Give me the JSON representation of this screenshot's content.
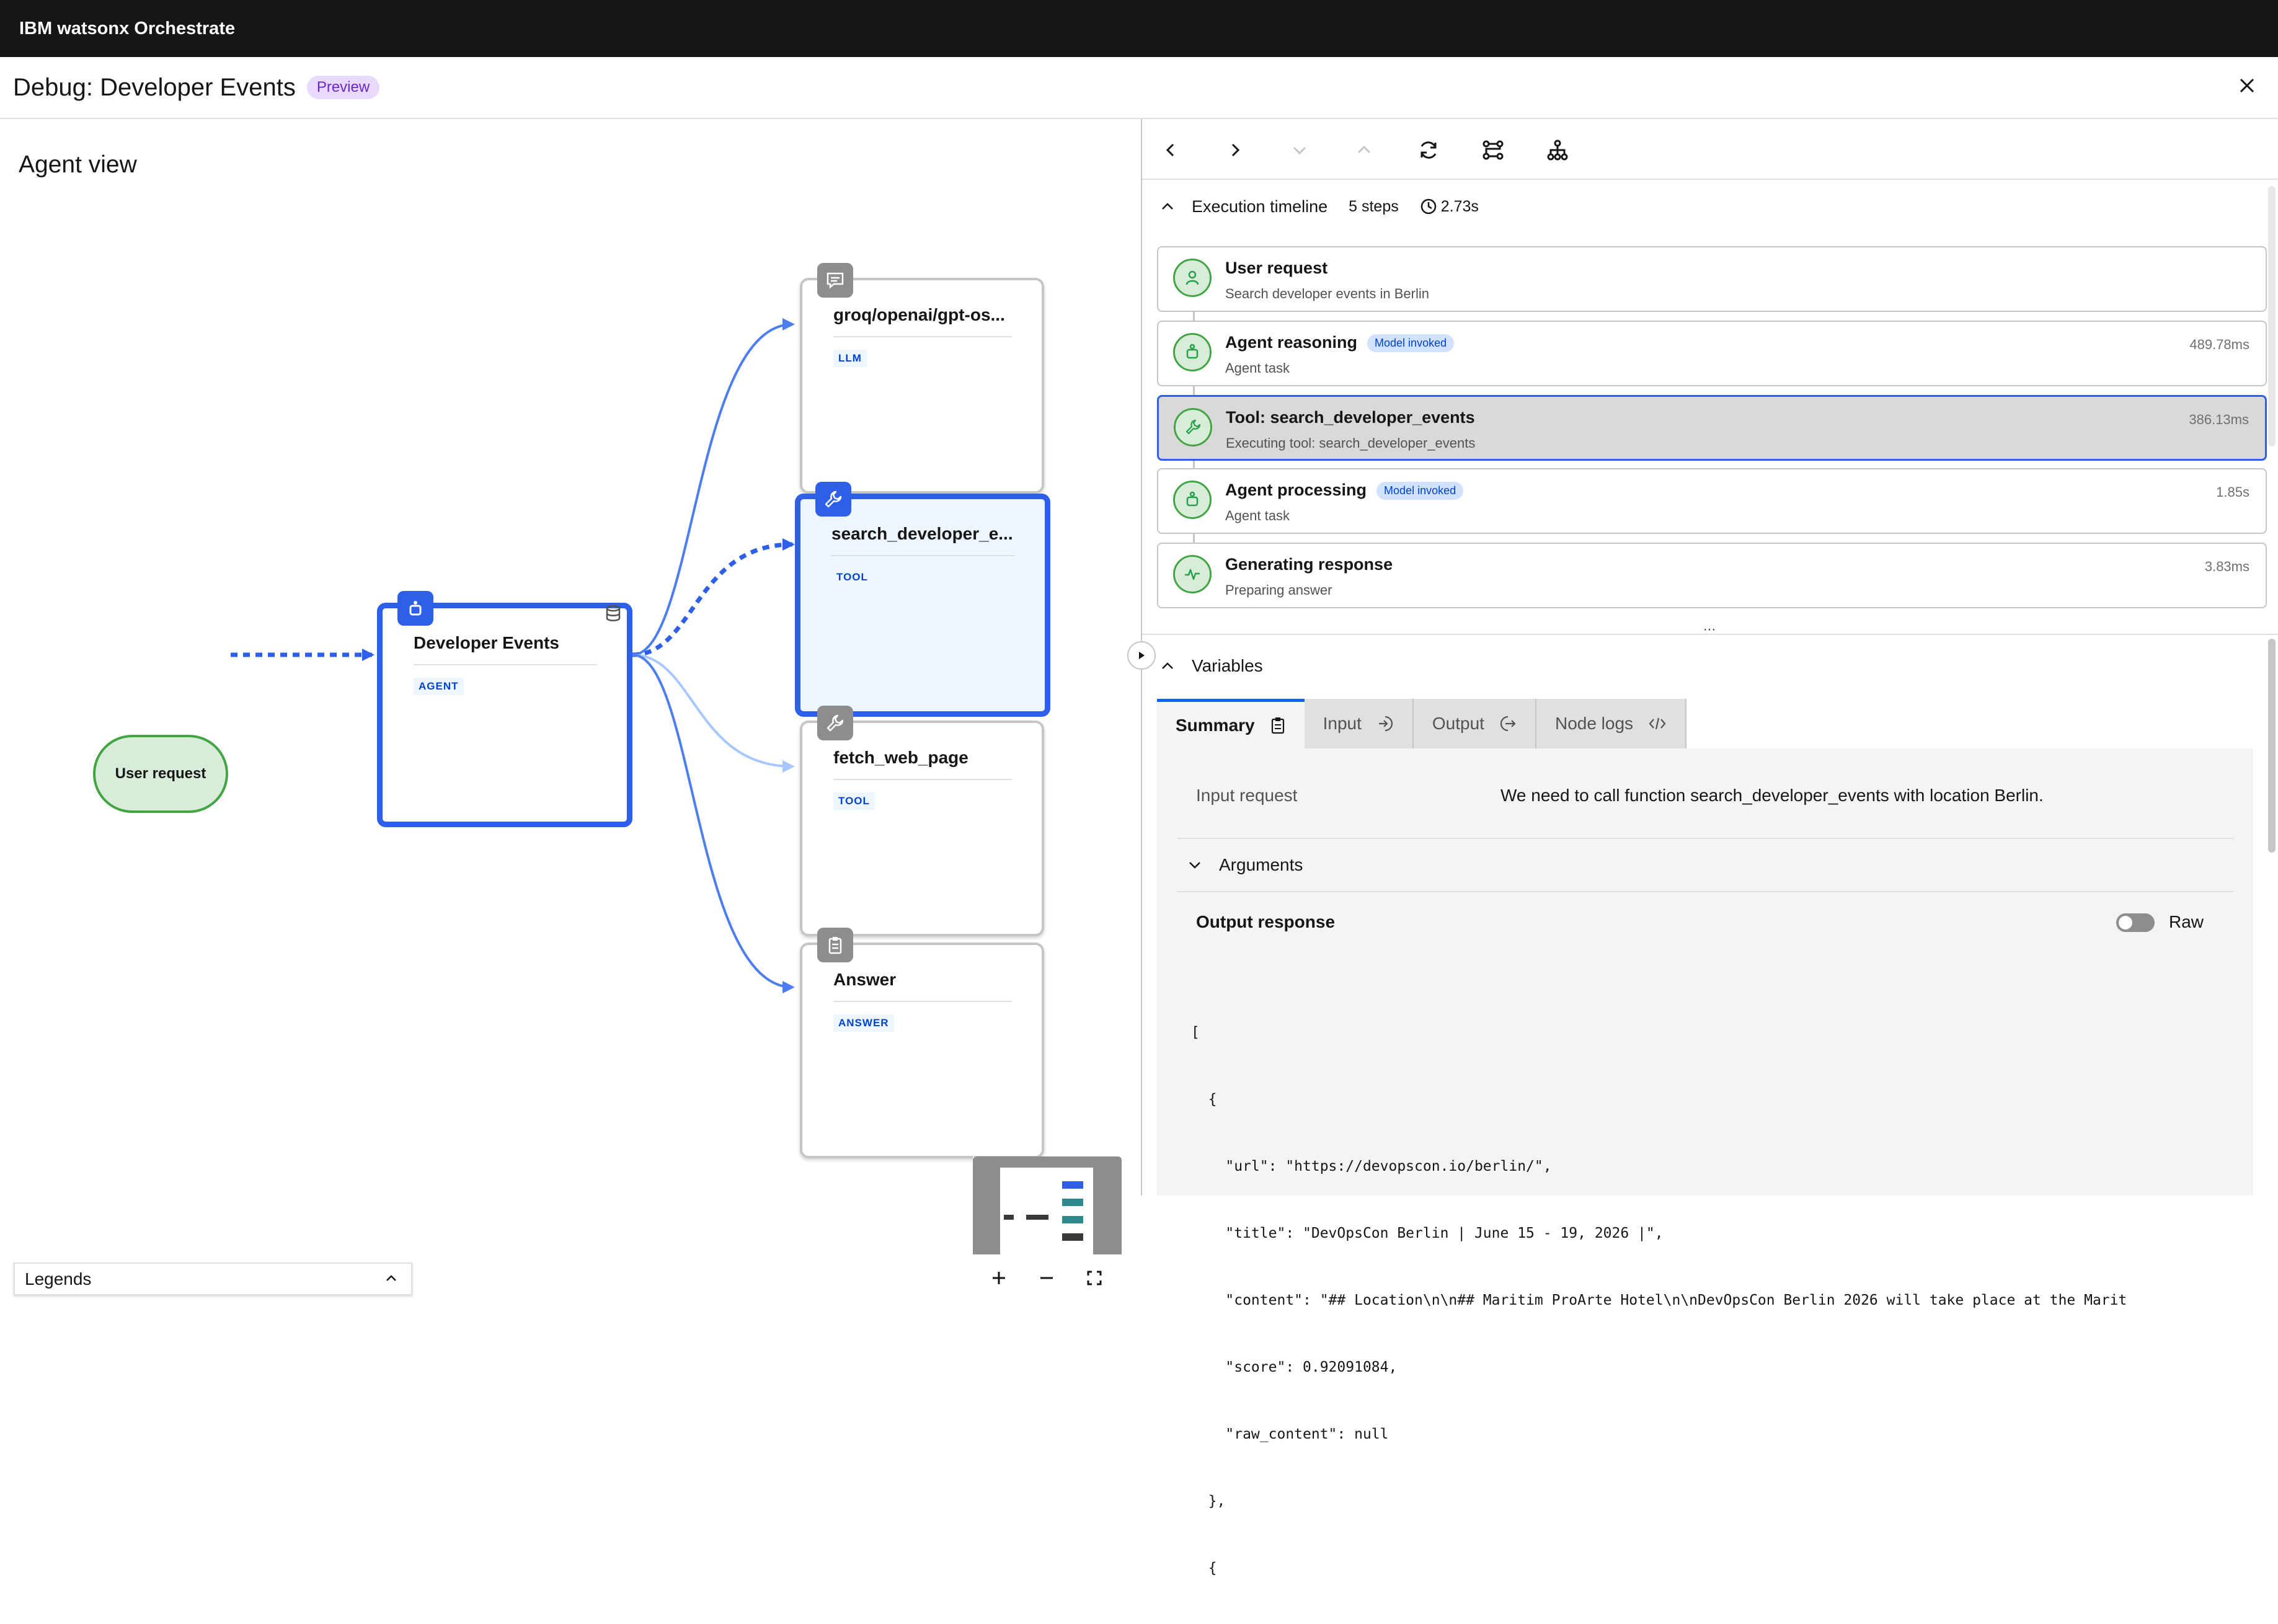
{
  "app": {
    "title": "IBM watsonx Orchestrate"
  },
  "debug": {
    "title": "Debug: Developer Events",
    "badge": "Preview"
  },
  "agent_view": {
    "title": "Agent view",
    "user_request_label": "User request",
    "agent_node": {
      "label": "Developer Events",
      "tag": "AGENT",
      "icon": "agent-icon"
    },
    "nodes": [
      {
        "label": "groq/openai/gpt-os...",
        "tag": "LLM",
        "icon": "chat-icon"
      },
      {
        "label": "search_developer_e...",
        "tag": "TOOL",
        "icon": "wrench-icon"
      },
      {
        "label": "fetch_web_page",
        "tag": "TOOL",
        "icon": "wrench-icon"
      },
      {
        "label": "Answer",
        "tag": "ANSWER",
        "icon": "clipboard-icon"
      }
    ],
    "legends_label": "Legends"
  },
  "timeline": {
    "title": "Execution timeline",
    "steps_count": "5 steps",
    "duration": "2.73s",
    "steps": [
      {
        "title": "User request",
        "subtitle": "Search developer events in Berlin",
        "time": "",
        "badge": ""
      },
      {
        "title": "Agent reasoning",
        "subtitle": "Agent task",
        "time": "489.78ms",
        "badge": "Model invoked"
      },
      {
        "title": "Tool: search_developer_events",
        "subtitle": "Executing tool: search_developer_events",
        "time": "386.13ms",
        "badge": ""
      },
      {
        "title": "Agent processing",
        "subtitle": "Agent task",
        "time": "1.85s",
        "badge": "Model invoked"
      },
      {
        "title": "Generating response",
        "subtitle": "Preparing answer",
        "time": "3.83ms",
        "badge": ""
      }
    ]
  },
  "variables": {
    "title": "Variables",
    "tabs": [
      "Summary",
      "Input",
      "Output",
      "Node logs"
    ],
    "input_request_label": "Input request",
    "input_request_value": "We need to call function search_developer_events with location Berlin.",
    "arguments_label": "Arguments",
    "output_response_label": "Output response",
    "raw_label": "Raw",
    "code_lines": [
      "[",
      "  {",
      "    \"url\": \"https://devopscon.io/berlin/\",",
      "    \"title\": \"DevOpsCon Berlin | June 15 - 19, 2026 |\",",
      "    \"content\": \"## Location\\n\\n## Maritim ProArte Hotel\\n\\nDevOpsCon Berlin 2026 will take place at the Marit",
      "    \"score\": 0.92091084,",
      "    \"raw_content\": null",
      "  },",
      "  {"
    ]
  },
  "colors": {
    "accent": "#2d5fe9",
    "success": "#42a442",
    "topbar": "#161616"
  }
}
